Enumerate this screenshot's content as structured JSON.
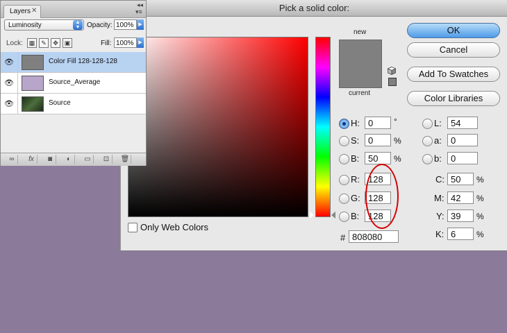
{
  "picker": {
    "title": "Pick a solid color:",
    "new_label": "new",
    "current_label": "current",
    "only_web_colors": "Only Web Colors",
    "buttons": {
      "ok": "OK",
      "cancel": "Cancel",
      "add_swatches": "Add To Swatches",
      "libraries": "Color Libraries"
    },
    "hsb": {
      "h_label": "H:",
      "h": "0",
      "h_unit": "°",
      "s_label": "S:",
      "s": "0",
      "s_unit": "%",
      "b_label": "B:",
      "b": "50",
      "b_unit": "%"
    },
    "rgb": {
      "r_label": "R:",
      "r": "128",
      "g_label": "G:",
      "g": "128",
      "b_label": "B:",
      "b": "128"
    },
    "hex_label": "#",
    "hex": "808080",
    "lab": {
      "l_label": "L:",
      "l": "54",
      "a_label": "a:",
      "a": "0",
      "b_label": "b:",
      "b": "0"
    },
    "cmyk": {
      "c_label": "C:",
      "c": "50",
      "m_label": "M:",
      "m": "42",
      "y_label": "Y:",
      "y": "39",
      "k_label": "K:",
      "k": "6",
      "unit": "%"
    },
    "colors": {
      "new": "#808080",
      "current": "#808080",
      "highlight": "#d40000"
    }
  },
  "layers": {
    "tab": "Layers",
    "blend_mode": "Luminosity",
    "opacity_label": "Opacity:",
    "opacity": "100%",
    "lock_label": "Lock:",
    "fill_label": "Fill:",
    "fill": "100%",
    "rows": [
      {
        "name": "Color Fill 128-128-128",
        "selected": true,
        "thumb_color": "#808080"
      },
      {
        "name": "Source_Average",
        "selected": false,
        "thumb_color": "#b7a6c9"
      },
      {
        "name": "Source",
        "selected": false,
        "thumb_color": "#2f4a2c"
      }
    ]
  },
  "background_color": "#8b7a99"
}
